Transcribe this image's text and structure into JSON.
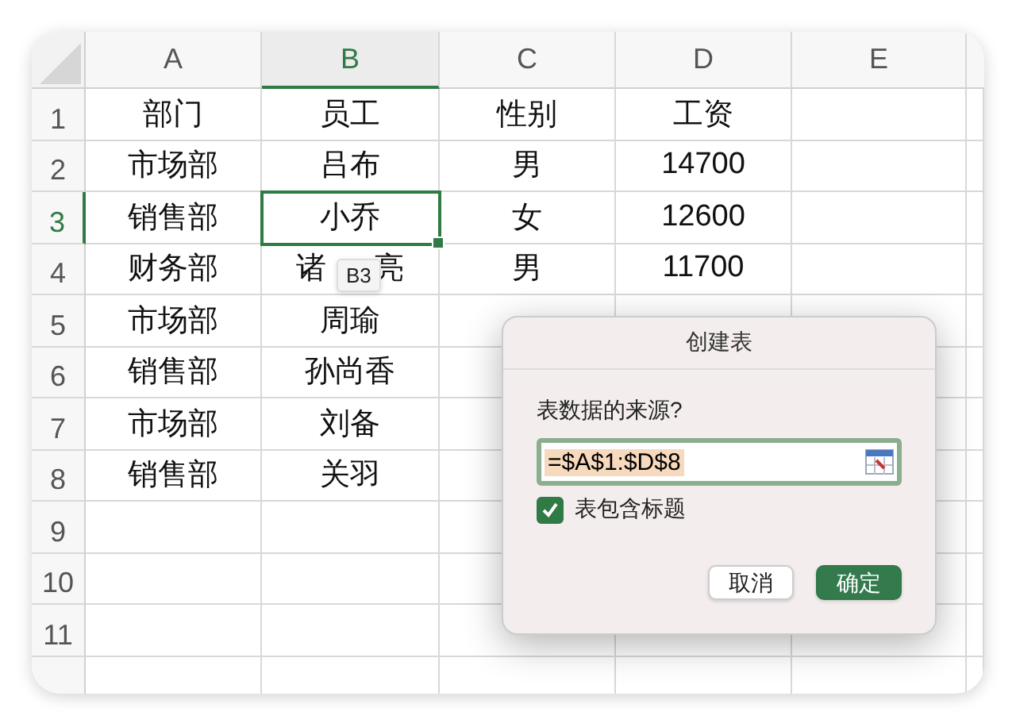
{
  "sheet": {
    "columns": [
      {
        "label": "A",
        "selected": false
      },
      {
        "label": "B",
        "selected": true
      },
      {
        "label": "C",
        "selected": false
      },
      {
        "label": "D",
        "selected": false
      },
      {
        "label": "E",
        "selected": false
      }
    ],
    "rows": [
      {
        "label": "1",
        "selected": false,
        "cells": [
          {
            "text": "部门",
            "selected": false
          },
          {
            "text": "员工",
            "selected": false
          },
          {
            "text": "性别",
            "selected": false
          },
          {
            "text": "工资",
            "selected": false
          }
        ]
      },
      {
        "label": "2",
        "selected": false,
        "cells": [
          {
            "text": "市场部",
            "selected": false
          },
          {
            "text": "吕布",
            "selected": false
          },
          {
            "text": "男",
            "selected": false
          },
          {
            "text": "14700",
            "selected": false
          }
        ]
      },
      {
        "label": "3",
        "selected": true,
        "cells": [
          {
            "text": "销售部",
            "selected": false
          },
          {
            "text": "小乔",
            "selected": true
          },
          {
            "text": "女",
            "selected": false
          },
          {
            "text": "12600",
            "selected": false
          }
        ]
      },
      {
        "label": "4",
        "selected": false,
        "cells": [
          {
            "text": "财务部",
            "selected": false
          },
          {
            "text": "诸 亮",
            "selected": false
          },
          {
            "text": "男",
            "selected": false
          },
          {
            "text": "11700",
            "selected": false
          }
        ]
      },
      {
        "label": "5",
        "selected": false,
        "cells": [
          {
            "text": "市场部",
            "selected": false
          },
          {
            "text": "周瑜",
            "selected": false
          }
        ]
      },
      {
        "label": "6",
        "selected": false,
        "cells": [
          {
            "text": "销售部",
            "selected": false
          },
          {
            "text": "孙尚香",
            "selected": false
          }
        ]
      },
      {
        "label": "7",
        "selected": false,
        "cells": [
          {
            "text": "市场部",
            "selected": false
          },
          {
            "text": "刘备",
            "selected": false
          }
        ]
      },
      {
        "label": "8",
        "selected": false,
        "cells": [
          {
            "text": "销售部",
            "selected": false
          },
          {
            "text": "关羽",
            "selected": false
          }
        ]
      },
      {
        "label": "9",
        "selected": false,
        "cells": []
      },
      {
        "label": "10",
        "selected": false,
        "cells": []
      },
      {
        "label": "11",
        "selected": false,
        "cells": []
      }
    ]
  },
  "cell_tooltip": "B3",
  "dialog": {
    "title": "创建表",
    "prompt": "表数据的来源?",
    "range_field": {
      "value": "=$A$1:$D$8"
    },
    "header_checkbox": {
      "label": "表包含标题",
      "checked": true
    },
    "buttons": [
      {
        "label": "取消",
        "primary": false
      },
      {
        "label": "确定",
        "primary": true
      }
    ]
  }
}
